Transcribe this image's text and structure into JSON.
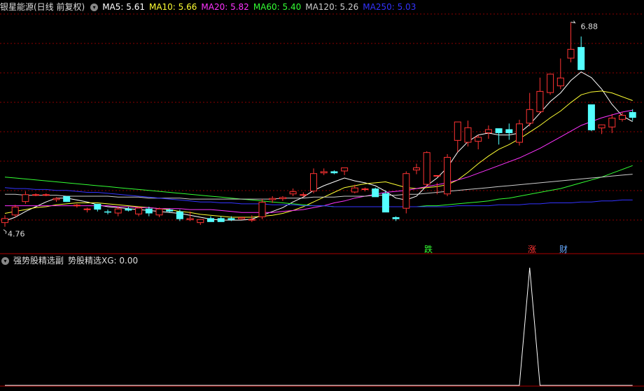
{
  "main_header": {
    "title": "银星能源(日线 前复权)",
    "ma": [
      {
        "label": "MA5: 5.61",
        "color": "#ffffff"
      },
      {
        "label": "MA10: 5.66",
        "color": "#ffff33"
      },
      {
        "label": "MA20: 5.82",
        "color": "#ff33ff"
      },
      {
        "label": "MA60: 5.40",
        "color": "#33ff33"
      },
      {
        "label": "MA120: 5.26",
        "color": "#cccccc"
      },
      {
        "label": "MA250: 5.03",
        "color": "#3333ff"
      }
    ]
  },
  "sub_header": {
    "title": "强势股精选副",
    "xg_label": "势股精选XG: 0.00"
  },
  "signals": [
    {
      "text": "跌",
      "color": "#33ff33"
    },
    {
      "text": "涨",
      "color": "#ff3333"
    },
    {
      "text": "财",
      "color": "#66aaff"
    }
  ],
  "price_labels": {
    "high": "6.88",
    "low": "4.76"
  },
  "colors": {
    "up": "#ff3333",
    "down": "#54ffff",
    "bg": "#000000",
    "grid": "#8b0000"
  },
  "chart_data": {
    "type": "candlestick",
    "ylim": [
      4.62,
      6.98
    ],
    "candles": [
      [
        4.78,
        4.86,
        4.74,
        4.83
      ],
      [
        4.86,
        4.97,
        4.84,
        4.95
      ],
      [
        5.0,
        5.11,
        4.98,
        5.08
      ],
      [
        5.08,
        5.09,
        5.06,
        5.08
      ],
      [
        5.07,
        5.09,
        5.06,
        5.08
      ],
      [
        5.02,
        5.05,
        5.0,
        5.04
      ],
      [
        5.06,
        5.04,
        5.0,
        5.0
      ],
      [
        4.96,
        4.98,
        4.94,
        4.97
      ],
      [
        4.92,
        4.94,
        4.89,
        4.93
      ],
      [
        4.98,
        4.98,
        4.9,
        4.92
      ],
      [
        4.9,
        4.92,
        4.87,
        4.89
      ],
      [
        4.88,
        4.95,
        4.85,
        4.93
      ],
      [
        4.93,
        4.95,
        4.9,
        4.91
      ],
      [
        4.87,
        4.95,
        4.85,
        4.94
      ],
      [
        4.93,
        4.95,
        4.85,
        4.88
      ],
      [
        4.86,
        4.94,
        4.84,
        4.93
      ],
      [
        4.92,
        4.93,
        4.89,
        4.9
      ],
      [
        4.9,
        4.92,
        4.8,
        4.82
      ],
      [
        4.81,
        4.9,
        4.8,
        4.83
      ],
      [
        4.78,
        4.82,
        4.76,
        4.82
      ],
      [
        4.83,
        4.85,
        4.81,
        4.79
      ],
      [
        4.83,
        4.85,
        4.8,
        4.79
      ],
      [
        4.83,
        4.85,
        4.8,
        4.81
      ],
      [
        4.82,
        4.83,
        4.81,
        4.84
      ],
      [
        4.81,
        4.86,
        4.79,
        4.82
      ],
      [
        4.84,
        5.03,
        4.82,
        5.0
      ],
      [
        5.02,
        5.06,
        4.99,
        5.04
      ],
      [
        5.03,
        5.06,
        5.01,
        5.05
      ],
      [
        5.08,
        5.14,
        5.06,
        5.11
      ],
      [
        5.07,
        5.1,
        5.05,
        5.08
      ],
      [
        5.11,
        5.35,
        5.09,
        5.3
      ],
      [
        5.3,
        5.35,
        5.28,
        5.32
      ],
      [
        5.32,
        5.33,
        5.29,
        5.3
      ],
      [
        5.32,
        5.34,
        5.28,
        5.36
      ],
      [
        5.1,
        5.18,
        5.09,
        5.15
      ],
      [
        5.14,
        5.15,
        5.11,
        5.14
      ],
      [
        5.14,
        5.15,
        5.11,
        5.05
      ],
      [
        5.09,
        5.12,
        4.98,
        4.89
      ],
      [
        4.84,
        4.85,
        4.8,
        4.82
      ],
      [
        4.93,
        5.32,
        4.88,
        5.3
      ],
      [
        5.33,
        5.4,
        5.29,
        5.36
      ],
      [
        5.18,
        5.53,
        5.16,
        5.52
      ],
      [
        5.28,
        5.2,
        5.08,
        5.28
      ],
      [
        5.08,
        5.5,
        5.06,
        5.47
      ],
      [
        5.64,
        5.72,
        5.52,
        5.84
      ],
      [
        5.62,
        5.85,
        5.58,
        5.78
      ],
      [
        5.63,
        5.7,
        5.55,
        5.68
      ],
      [
        5.72,
        5.8,
        5.66,
        5.76
      ],
      [
        5.77,
        5.76,
        5.6,
        5.72
      ],
      [
        5.76,
        5.82,
        5.65,
        5.72
      ],
      [
        5.62,
        5.86,
        5.59,
        5.82
      ],
      [
        5.82,
        6.14,
        5.79,
        5.97
      ],
      [
        5.94,
        6.3,
        5.92,
        6.16
      ],
      [
        6.14,
        6.28,
        6.12,
        6.34
      ],
      [
        6.21,
        6.5,
        6.18,
        6.3
      ],
      [
        6.5,
        6.88,
        6.46,
        6.6
      ],
      [
        6.62,
        6.73,
        6.38,
        6.38
      ],
      [
        6.02,
        6.02,
        5.74,
        5.75
      ],
      [
        5.77,
        5.81,
        5.71,
        5.81
      ],
      [
        5.78,
        5.92,
        5.72,
        5.88
      ],
      [
        5.86,
        5.94,
        5.84,
        5.91
      ],
      [
        5.94,
        5.97,
        5.85,
        5.88
      ]
    ],
    "ma_series": [
      {
        "name": "MA5",
        "color": "#ffffff",
        "values": [
          4.8,
          4.84,
          4.9,
          4.95,
          5.0,
          5.04,
          5.04,
          5.02,
          5.0,
          4.97,
          4.95,
          4.94,
          4.93,
          4.92,
          4.91,
          4.9,
          4.89,
          4.88,
          4.86,
          4.84,
          4.82,
          4.81,
          4.81,
          4.81,
          4.82,
          4.86,
          4.9,
          4.94,
          5.0,
          5.05,
          5.12,
          5.17,
          5.21,
          5.25,
          5.22,
          5.2,
          5.17,
          5.11,
          5.04,
          5.02,
          5.06,
          5.17,
          5.25,
          5.36,
          5.52,
          5.63,
          5.7,
          5.72,
          5.7,
          5.7,
          5.72,
          5.81,
          5.93,
          6.05,
          6.14,
          6.27,
          6.36,
          6.3,
          6.18,
          6.02,
          5.9,
          5.84
        ]
      },
      {
        "name": "MA10",
        "color": "#ffff33",
        "values": [
          4.88,
          4.9,
          4.92,
          4.94,
          4.95,
          4.97,
          4.98,
          4.99,
          4.99,
          4.99,
          4.98,
          4.97,
          4.96,
          4.95,
          4.94,
          4.93,
          4.92,
          4.9,
          4.89,
          4.87,
          4.86,
          4.85,
          4.84,
          4.84,
          4.84,
          4.85,
          4.86,
          4.88,
          4.91,
          4.95,
          5.0,
          5.05,
          5.1,
          5.15,
          5.17,
          5.19,
          5.2,
          5.21,
          5.18,
          5.15,
          5.14,
          5.15,
          5.16,
          5.18,
          5.23,
          5.31,
          5.4,
          5.48,
          5.55,
          5.6,
          5.66,
          5.73,
          5.8,
          5.88,
          5.95,
          6.04,
          6.12,
          6.15,
          6.16,
          6.14,
          6.1,
          6.06
        ]
      },
      {
        "name": "MA20",
        "color": "#ff33ff",
        "values": [
          4.96,
          4.96,
          4.96,
          4.96,
          4.96,
          4.96,
          4.96,
          4.96,
          4.96,
          4.96,
          4.96,
          4.95,
          4.95,
          4.94,
          4.94,
          4.93,
          4.93,
          4.93,
          4.92,
          4.92,
          4.92,
          4.91,
          4.9,
          4.89,
          4.89,
          4.89,
          4.89,
          4.9,
          4.91,
          4.92,
          4.94,
          4.96,
          4.99,
          5.01,
          5.04,
          5.06,
          5.08,
          5.1,
          5.11,
          5.12,
          5.14,
          5.16,
          5.18,
          5.2,
          5.23,
          5.26,
          5.3,
          5.34,
          5.38,
          5.42,
          5.46,
          5.51,
          5.56,
          5.62,
          5.68,
          5.74,
          5.8,
          5.84,
          5.88,
          5.91,
          5.94,
          5.96
        ]
      },
      {
        "name": "MA60",
        "color": "#33ff33",
        "values": [
          5.26,
          5.25,
          5.24,
          5.23,
          5.22,
          5.21,
          5.2,
          5.19,
          5.18,
          5.17,
          5.16,
          5.15,
          5.14,
          5.13,
          5.12,
          5.11,
          5.1,
          5.09,
          5.08,
          5.07,
          5.06,
          5.05,
          5.04,
          5.03,
          5.02,
          5.01,
          5.0,
          4.99,
          4.98,
          4.97,
          4.96,
          4.96,
          4.95,
          4.95,
          4.95,
          4.95,
          4.95,
          4.95,
          4.95,
          4.95,
          4.95,
          4.96,
          4.96,
          4.97,
          4.98,
          4.99,
          5.0,
          5.01,
          5.03,
          5.04,
          5.06,
          5.08,
          5.1,
          5.12,
          5.14,
          5.17,
          5.2,
          5.23,
          5.26,
          5.3,
          5.34,
          5.38
        ]
      },
      {
        "name": "MA120",
        "color": "#cccccc",
        "values": [
          5.08,
          5.08,
          5.07,
          5.07,
          5.07,
          5.07,
          5.06,
          5.06,
          5.06,
          5.06,
          5.06,
          5.05,
          5.05,
          5.05,
          5.04,
          5.04,
          5.04,
          5.04,
          5.03,
          5.03,
          5.03,
          5.03,
          5.03,
          5.03,
          5.03,
          5.03,
          5.03,
          5.04,
          5.04,
          5.04,
          5.05,
          5.05,
          5.05,
          5.06,
          5.06,
          5.06,
          5.07,
          5.07,
          5.07,
          5.08,
          5.08,
          5.09,
          5.1,
          5.11,
          5.12,
          5.13,
          5.14,
          5.15,
          5.16,
          5.17,
          5.18,
          5.19,
          5.2,
          5.21,
          5.22,
          5.23,
          5.24,
          5.25,
          5.26,
          5.27,
          5.28,
          5.29
        ]
      },
      {
        "name": "MA250",
        "color": "#3333ff",
        "values": [
          5.15,
          5.14,
          5.14,
          5.13,
          5.13,
          5.12,
          5.12,
          5.11,
          5.1,
          5.1,
          5.09,
          5.08,
          5.07,
          5.06,
          5.05,
          5.04,
          5.03,
          5.02,
          5.01,
          5.0,
          5.0,
          4.99,
          4.99,
          4.98,
          4.98,
          4.98,
          4.97,
          4.97,
          4.97,
          4.96,
          4.96,
          4.96,
          4.95,
          4.95,
          4.95,
          4.95,
          4.95,
          4.95,
          4.95,
          4.95,
          4.95,
          4.95,
          4.95,
          4.95,
          4.96,
          4.96,
          4.96,
          4.96,
          4.97,
          4.97,
          4.97,
          4.98,
          4.98,
          4.99,
          4.99,
          4.99,
          5.0,
          5.0,
          5.01,
          5.01,
          5.02,
          5.02
        ]
      }
    ],
    "indicator": {
      "name": "XG",
      "ylim": [
        0,
        1
      ],
      "values": [
        0,
        0,
        0,
        0,
        0,
        0,
        0,
        0,
        0,
        0,
        0,
        0,
        0,
        0,
        0,
        0,
        0,
        0,
        0,
        0,
        0,
        0,
        0,
        0,
        0,
        0,
        0,
        0,
        0,
        0,
        0,
        0,
        0,
        0,
        0,
        0,
        0,
        0,
        0,
        0,
        0,
        0,
        0,
        0,
        0,
        0,
        0,
        0,
        0,
        0,
        0,
        1,
        0,
        0,
        0,
        0,
        0,
        0,
        0,
        0,
        0,
        0
      ]
    }
  }
}
